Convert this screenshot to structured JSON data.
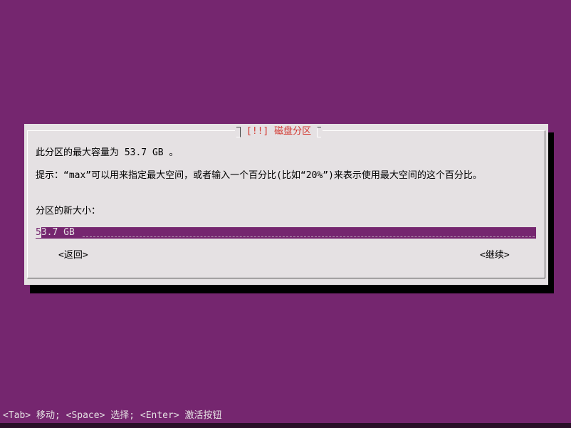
{
  "dialog": {
    "title": "[!!] 磁盘分区",
    "line1": "此分区的最大容量为 53.7 GB 。",
    "hint": "提示：“max”可以用来指定最大空间，或者输入一个百分比(比如“20%”)来表示使用最大空间的这个百分比。",
    "label": "分区的新大小：",
    "input": {
      "cursor_char": "5",
      "rest_value": "3.7 GB"
    },
    "buttons": {
      "back": "<返回>",
      "continue": "<继续>"
    }
  },
  "statusbar": {
    "text": "<Tab> 移动; <Space> 选择; <Enter> 激活按钮"
  },
  "colors": {
    "background": "#75266f",
    "dialog": "#e5e1e3",
    "title": "#d2352d"
  }
}
